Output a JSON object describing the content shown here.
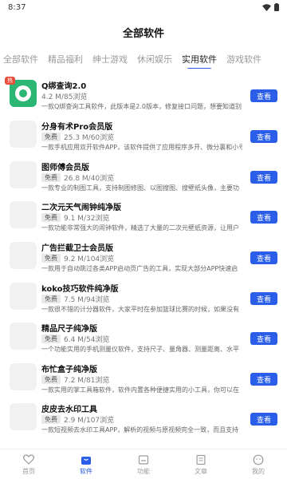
{
  "status_bar": {
    "time": "8:37"
  },
  "header": {
    "title": "全部软件"
  },
  "tabs": [
    {
      "label": "全部软件",
      "active": false
    },
    {
      "label": "精品福利",
      "active": false
    },
    {
      "label": "绅士游戏",
      "active": false
    },
    {
      "label": "休闲娱乐",
      "active": false
    },
    {
      "label": "实用软件",
      "active": true
    },
    {
      "label": "游戏软件",
      "active": false
    }
  ],
  "items": [
    {
      "name": "Q绑查询2.0",
      "badge": "",
      "size": "4.2 M/85浏览",
      "desc": "一款Q绑查询工具软件，此版本是2.0版本，修复接口问题，想要知道别",
      "button": "查看",
      "has_logo": true,
      "logo_badge": "热"
    },
    {
      "name": "分身有术Pro会员版",
      "badge": "免费",
      "size": "25.3 M/60浏览",
      "desc": "一款手机应用双开软件APP，该软件提供了应用程序多开、微分裏和小号",
      "button": "查看"
    },
    {
      "name": "图师傅会员版",
      "badge": "免费",
      "size": "26.8 M/40浏览",
      "desc": "一款专业的制图工具，支持制图修图、以图搜图、搜壁纸头像，主要功",
      "button": "查看"
    },
    {
      "name": "二次元天气闹钟纯净版",
      "badge": "免费",
      "size": "9.1 M/32浏览",
      "desc": "一款功能非常强大的闹钟软件，精选了大量的二次元壁纸资源，让用户",
      "button": "查看"
    },
    {
      "name": "广告拦截卫士会员版",
      "badge": "免费",
      "size": "9.2 M/104浏览",
      "desc": "一款用于自动跳过各类APP启动页广告的工具，实现大部分APP快速启",
      "button": "查看"
    },
    {
      "name": "koko技巧软件纯净版",
      "badge": "免费",
      "size": "7.5 M/94浏览",
      "desc": "一款很不错的计分器软件，大家平时在参加篮球比赛的时候，如果没有",
      "button": "查看"
    },
    {
      "name": "精品尺子纯净版",
      "badge": "免费",
      "size": "6.4 M/54浏览",
      "desc": "一个功能实用的手机测量仪软件，支持尺子、量角器、测量距离、水平",
      "button": "查看"
    },
    {
      "name": "布忙盒子纯净版",
      "badge": "免费",
      "size": "7.2 M/81浏览",
      "desc": "一款实用的掌工具箱软件，软件内置各种便捷实用的小工具，你可以在",
      "button": "查看"
    },
    {
      "name": "皮皮去水印工具",
      "badge": "免费",
      "size": "2.9 M/107浏览",
      "desc": "一款短视频去水印工具APP，解析的视频与原视频完全一致，而且支持",
      "button": "查看"
    }
  ],
  "bottom_nav": [
    {
      "label": "首页",
      "icon": "heart-icon",
      "active": false
    },
    {
      "label": "软件",
      "icon": "bag-icon",
      "active": true
    },
    {
      "label": "功能",
      "icon": "box-icon",
      "active": false
    },
    {
      "label": "文章",
      "icon": "doc-icon",
      "active": false
    },
    {
      "label": "我的",
      "icon": "face-icon",
      "active": false
    }
  ],
  "colors": {
    "accent": "#2a5de8",
    "logo_green": "#2bb673",
    "hot_badge": "#e94b3c"
  }
}
